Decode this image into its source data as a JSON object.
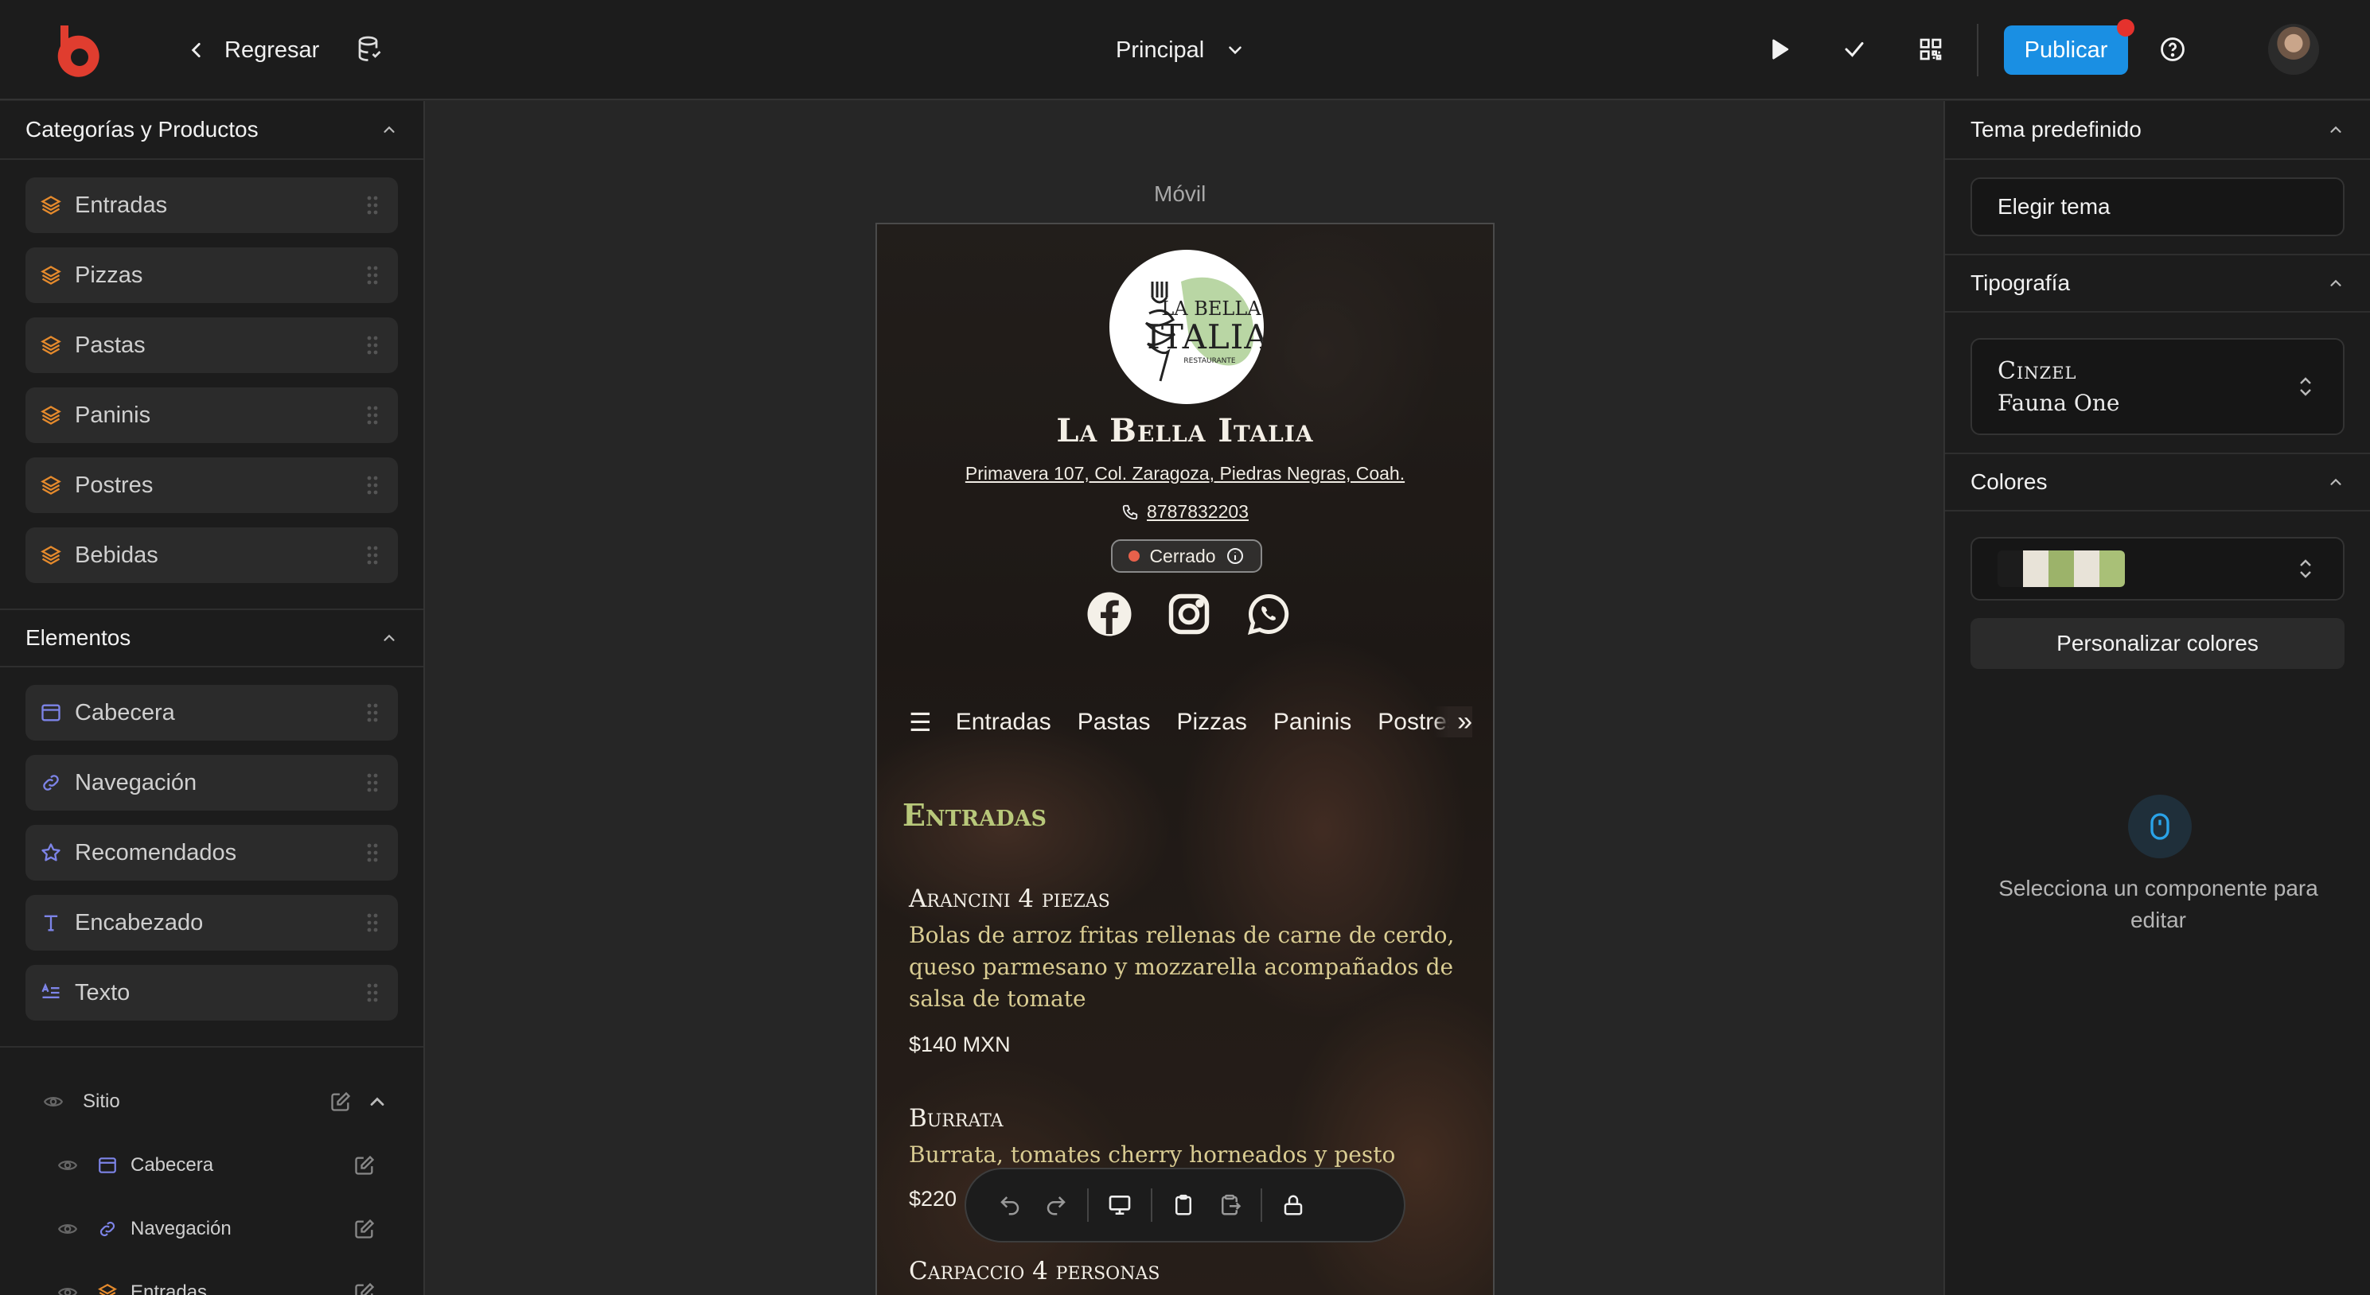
{
  "topbar": {
    "back_label": "Regresar",
    "page_selector": "Principal",
    "publish_label": "Publicar",
    "accent": "#1a8fe3"
  },
  "left_panel": {
    "categories_title": "Categorías y Productos",
    "categories": [
      {
        "label": "Entradas",
        "icon": "layers-icon"
      },
      {
        "label": "Pizzas",
        "icon": "layers-icon"
      },
      {
        "label": "Pastas",
        "icon": "layers-icon"
      },
      {
        "label": "Paninis",
        "icon": "layers-icon"
      },
      {
        "label": "Postres",
        "icon": "layers-icon"
      },
      {
        "label": "Bebidas",
        "icon": "layers-icon"
      }
    ],
    "elements_title": "Elementos",
    "elements": [
      {
        "label": "Cabecera",
        "icon": "header-icon"
      },
      {
        "label": "Navegación",
        "icon": "link-icon"
      },
      {
        "label": "Recomendados",
        "icon": "star-icon"
      },
      {
        "label": "Encabezado",
        "icon": "heading-icon"
      },
      {
        "label": "Texto",
        "icon": "text-icon"
      }
    ],
    "tree": [
      {
        "label": "Sitio"
      },
      {
        "label": "Cabecera"
      },
      {
        "label": "Navegación"
      },
      {
        "label": "Entradas"
      }
    ]
  },
  "canvas": {
    "device_label": "Móvil",
    "restaurant_name": "La Bella Italia",
    "logo_text": [
      "LA BELLA",
      "ITALIA",
      "RESTAURANTE"
    ],
    "address": "Primavera 107, Col. Zaragoza, Piedras Negras, Coah.",
    "phone": "8787832203",
    "status": "Cerrado",
    "nav_items": [
      "Entradas",
      "Pastas",
      "Pizzas",
      "Paninis",
      "Postres"
    ],
    "section_title": "Entradas",
    "items": [
      {
        "name": "Arancini 4 piezas",
        "desc": "Bolas de arroz fritas rellenas de carne de cerdo, queso parmesano y mozzarella acompañados de salsa de tomate",
        "price": "$140 MXN"
      },
      {
        "name": "Burrata",
        "desc": "Burrata, tomates cherry horneados y pesto",
        "price": "$220"
      },
      {
        "name": "Carpaccio 4 personas",
        "desc": "",
        "price": ""
      }
    ]
  },
  "right_panel": {
    "theme_title": "Tema predefinido",
    "theme_button": "Elegir tema",
    "typography_title": "Tipografía",
    "font_heading": "Cinzel",
    "font_body": "Fauna One",
    "colors_title": "Colores",
    "palette": [
      "#1c1c1c",
      "#e8e3d8",
      "#9cb36a",
      "#e8e3d8",
      "#a9c077"
    ],
    "customize_label": "Personalizar colores",
    "hint": "Selecciona un componente para editar"
  }
}
